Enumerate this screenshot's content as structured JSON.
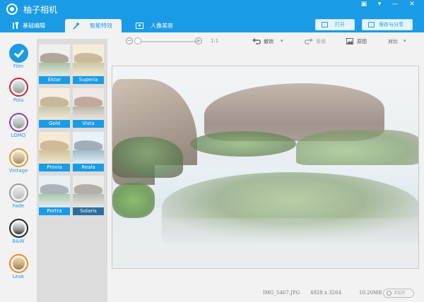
{
  "window": {
    "title": "柚子相机",
    "controls": [
      "▣",
      "▾",
      "—",
      "✕"
    ]
  },
  "tabs": [
    {
      "label": "基础编辑",
      "icon": "tools-icon",
      "active": false
    },
    {
      "label": "智能特效",
      "icon": "magic-wand-icon",
      "active": true
    },
    {
      "label": "人像美容",
      "icon": "portrait-icon",
      "active": false
    }
  ],
  "top_buttons": {
    "open": "打开",
    "save_share": "保存与分享"
  },
  "categories": [
    {
      "label": "Film",
      "selected": true,
      "color": "#1a9be6"
    },
    {
      "label": "Pola",
      "selected": false,
      "color": "#d0263d"
    },
    {
      "label": "LOMO",
      "selected": false,
      "color": "#8b3fa7"
    },
    {
      "label": "Vintage",
      "selected": false,
      "color": "#e89b2a"
    },
    {
      "label": "Fade",
      "selected": false,
      "color": "#9a9a9a"
    },
    {
      "label": "B&W",
      "selected": false,
      "color": "#222222"
    },
    {
      "label": "Leak",
      "selected": false,
      "color": "#f08c1e"
    }
  ],
  "filters": [
    {
      "name": "Ektar",
      "dark": false
    },
    {
      "name": "Superia",
      "dark": false
    },
    {
      "name": "Gold",
      "dark": false
    },
    {
      "name": "Vista",
      "dark": false
    },
    {
      "name": "Provia",
      "dark": false
    },
    {
      "name": "Reala",
      "dark": false
    },
    {
      "name": "Portra",
      "dark": false
    },
    {
      "name": "Solaris",
      "dark": true
    }
  ],
  "toolbar": {
    "zoom_ratio": "1:1",
    "zoom_level": 0,
    "undo": "撤销",
    "redo": "重做",
    "original": "原图",
    "compare": "对比"
  },
  "status": {
    "filename": "IMG_5467.JPG",
    "dimensions": "4928 x 3264",
    "size": "10.20MB",
    "exif": "EXIF"
  }
}
